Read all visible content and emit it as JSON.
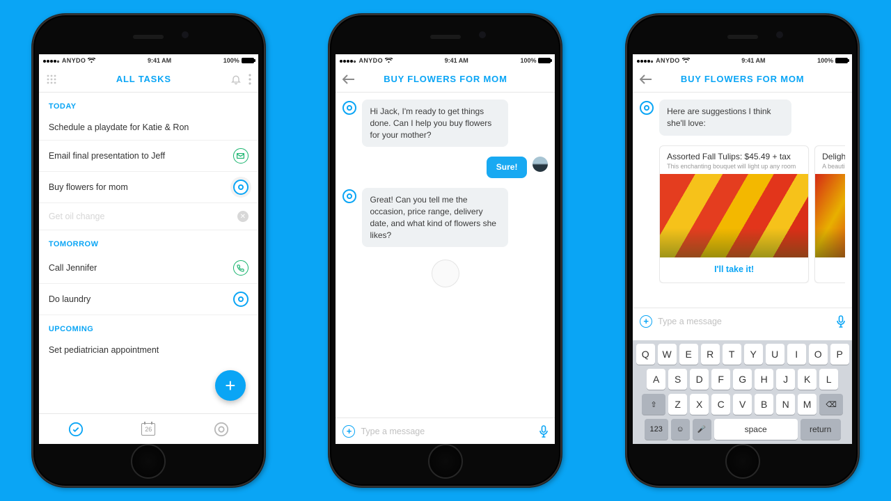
{
  "status": {
    "carrier": "ANYDO",
    "time": "9:41 AM",
    "battery": "100%"
  },
  "screen1": {
    "title": "ALL TASKS",
    "sections": [
      {
        "label": "TODAY",
        "tasks": [
          {
            "text": "Schedule a playdate for Katie & Ron",
            "icon": ""
          },
          {
            "text": "Email final presentation to Jeff",
            "icon": "mail"
          },
          {
            "text": "Buy flowers for mom",
            "icon": "ring"
          },
          {
            "text": "Get oil change",
            "icon": "x",
            "fade": true
          }
        ]
      },
      {
        "label": "TOMORROW",
        "tasks": [
          {
            "text": "Call Jennifer",
            "icon": "phone"
          },
          {
            "text": "Do laundry",
            "icon": "ring"
          }
        ]
      },
      {
        "label": "UPCOMING",
        "tasks": [
          {
            "text": "Set pediatrician appointment",
            "icon": ""
          }
        ]
      }
    ],
    "calendar_day": "26"
  },
  "screen2": {
    "title": "BUY FLOWERS FOR MOM",
    "messages": [
      {
        "from": "bot",
        "text": "Hi Jack, I'm ready to get things done. Can I help you buy flowers for your mother?"
      },
      {
        "from": "user",
        "text": "Sure!"
      },
      {
        "from": "bot",
        "text": "Great! Can you tell me the occasion, price range, delivery date, and what kind of flowers she likes?"
      }
    ],
    "placeholder": "Type a message"
  },
  "screen3": {
    "title": "BUY FLOWERS FOR MOM",
    "lead": "Here are suggestions I think she'll love:",
    "cards": [
      {
        "title": "Assorted Fall Tulips: $45.49 + tax",
        "sub": "This enchanting bouquet will light up any room",
        "cta": "I'll take it!"
      },
      {
        "title": "Deligh",
        "sub": "A beauti",
        "cta": ""
      }
    ],
    "placeholder": "Type a message",
    "keyboard": {
      "row1": [
        "Q",
        "W",
        "E",
        "R",
        "T",
        "Y",
        "U",
        "I",
        "O",
        "P"
      ],
      "row2": [
        "A",
        "S",
        "D",
        "F",
        "G",
        "H",
        "J",
        "K",
        "L"
      ],
      "row3": [
        "Z",
        "X",
        "C",
        "V",
        "B",
        "N",
        "M"
      ],
      "fn": {
        "shift": "⇧",
        "back": "⌫",
        "num": "123",
        "emoji": "☺",
        "mic": "🎤",
        "space": "space",
        "return": "return"
      }
    }
  }
}
